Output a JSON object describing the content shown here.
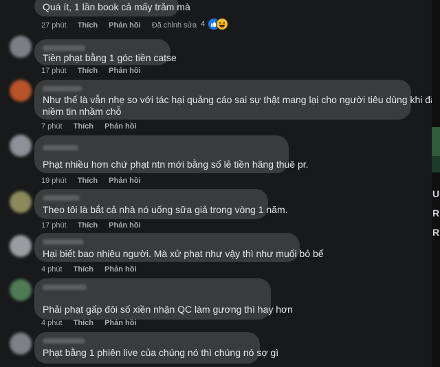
{
  "comments": [
    {
      "text": "Quá ít, 1 lần book cả mấy trăm mà",
      "time": "27 phút",
      "like": "Thích",
      "reply": "Phản hồi",
      "edited": "Đã chỉnh sửa",
      "reaction_count": "4",
      "reactions": [
        "like-icon",
        "haha-icon"
      ]
    },
    {
      "text": "Tiền phạt bằng 1 góc tiền catse",
      "time": "17 phút",
      "like": "Thích",
      "reply": "Phản hồi"
    },
    {
      "text_line1": "Như thế là vẫn nhẹ so với tác hại quảng cáo sai sự thật mang lại cho người tiêu dùng khi đặt",
      "text_line2": "niềm tin nhầm chỗ",
      "time": "7 phút",
      "like": "Thích",
      "reply": "Phản hồi"
    },
    {
      "text": "Phạt nhiều hơn chứ phạt ntn mới bằng số lẻ tiền hãng thuê pr.",
      "time": "19 phút",
      "like": "Thích",
      "reply": "Phản hồi"
    },
    {
      "text": "Theo tôi là bắt cả nhà nó uống sữa giả trong vòng 1 năm.",
      "time": "17 phút",
      "like": "Thích",
      "reply": "Phản hồi"
    },
    {
      "text": "Hại biết bao nhiêu người. Mà xử phạt như vậy thì như muối bỏ bể",
      "time": "4 phút",
      "like": "Thích",
      "reply": "Phản hồi"
    },
    {
      "text": "Phải phạt gấp đôi số xiền nhận QC làm gương thì hay hơn",
      "time": "4 phút",
      "like": "Thích",
      "reply": "Phản hồi"
    },
    {
      "text": "Phạt bằng 1 phiên live của chúng nó thì chúng nó sợ gì"
    }
  ],
  "right_edge_glyphs": [
    "U",
    "R",
    "R"
  ],
  "colors": {
    "background": "#18191a",
    "bubble": "#3a3b3c",
    "text": "#e4e6eb",
    "meta": "#a8abaf",
    "like_blue": "#1877f2",
    "haha_yellow": "#f7b928"
  }
}
